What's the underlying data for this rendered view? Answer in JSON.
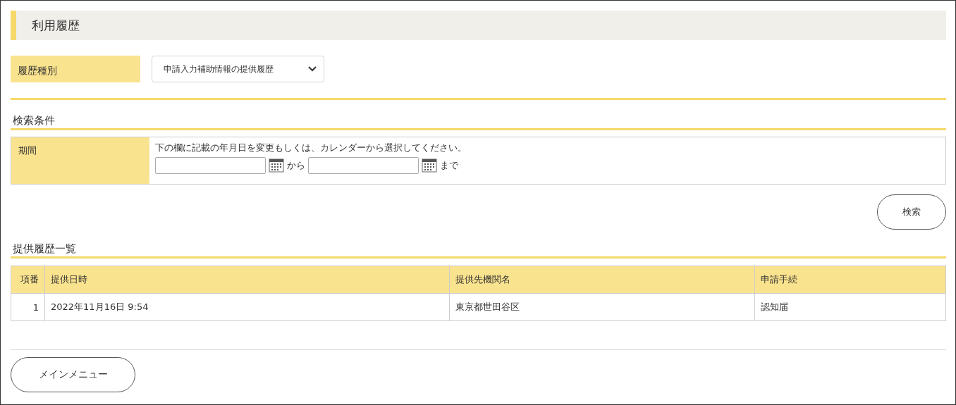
{
  "page_title": "利用履歴",
  "history_type": {
    "label": "履歴種別",
    "value": "申請入力補助情報の提供履歴"
  },
  "search_conditions": {
    "heading": "検索条件",
    "period_label": "期間",
    "instruction": "下の欄に記載の年月日を変更もしくは、カレンダーから選択してください。",
    "from_text": "から",
    "to_text": "まで",
    "search_button": "検索"
  },
  "history_list": {
    "heading": "提供履歴一覧",
    "columns": [
      "項番",
      "提供日時",
      "提供先機関名",
      "申請手続"
    ],
    "rows": [
      {
        "cells": [
          "1",
          "2022年11月16日 9:54",
          "東京都世田谷区",
          "認知届"
        ]
      }
    ]
  },
  "main_menu_button": "メインメニュー"
}
